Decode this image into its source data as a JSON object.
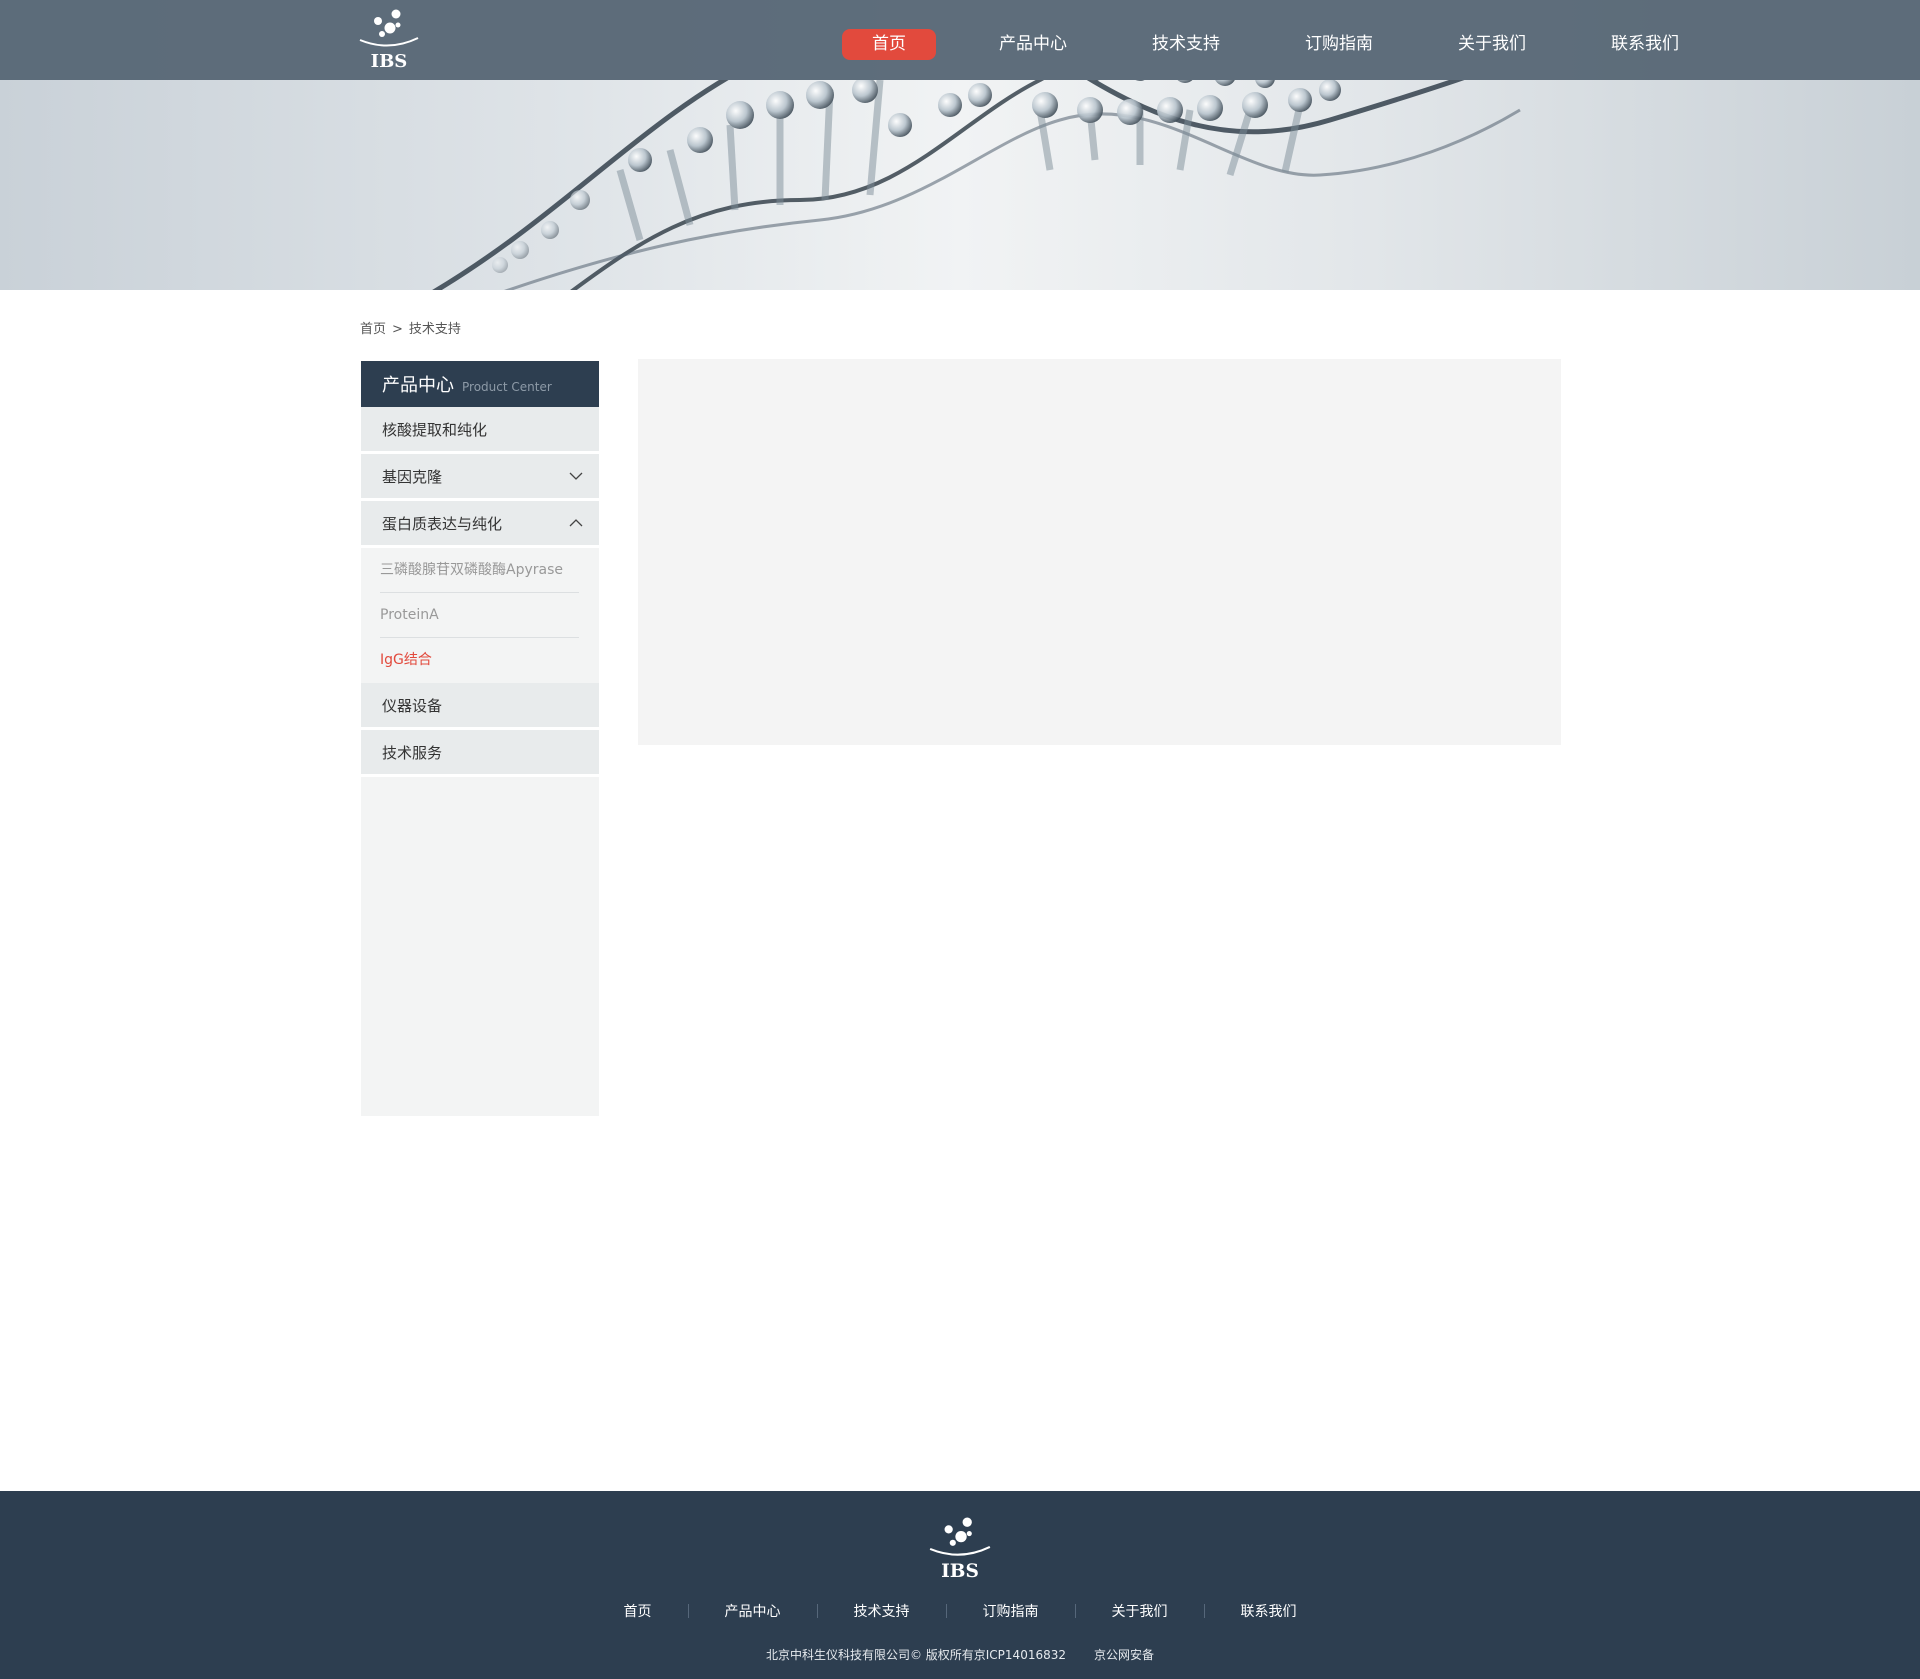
{
  "header": {
    "logo_text": "IBS",
    "nav": [
      {
        "label": "首页",
        "active": true
      },
      {
        "label": "产品中心",
        "active": false
      },
      {
        "label": "技术支持",
        "active": false
      },
      {
        "label": "订购指南",
        "active": false
      },
      {
        "label": "关于我们",
        "active": false
      },
      {
        "label": "联系我们",
        "active": false
      }
    ],
    "active_color": "#e24a3d"
  },
  "breadcrumb": {
    "home": "首页",
    "separator": ">",
    "current": "技术支持"
  },
  "sidebar": {
    "title_cn": "产品中心",
    "title_en": "Product Center",
    "categories": [
      {
        "label": "核酸提取和纯化",
        "icon": ""
      },
      {
        "label": "基因克隆",
        "icon": "chevron-down-icon"
      },
      {
        "label": "蛋白质表达与纯化",
        "icon": "chevron-up-icon"
      }
    ],
    "subitems": [
      {
        "label": "三磷酸腺苷双磷酸酶Apyrase",
        "active": false
      },
      {
        "label": "ProteinA",
        "active": false
      },
      {
        "label": "IgG结合",
        "active": true
      }
    ],
    "categories_after": [
      {
        "label": "仪器设备"
      },
      {
        "label": "技术服务"
      }
    ]
  },
  "footer": {
    "logo_text": "IBS",
    "nav": [
      "首页",
      "产品中心",
      "技术支持",
      "订购指南",
      "关于我们",
      "联系我们"
    ],
    "copyright": "北京中科生仪科技有限公司© 版权所有京ICP14016832",
    "police": "京公网安备",
    "background": "#2d3e50"
  }
}
